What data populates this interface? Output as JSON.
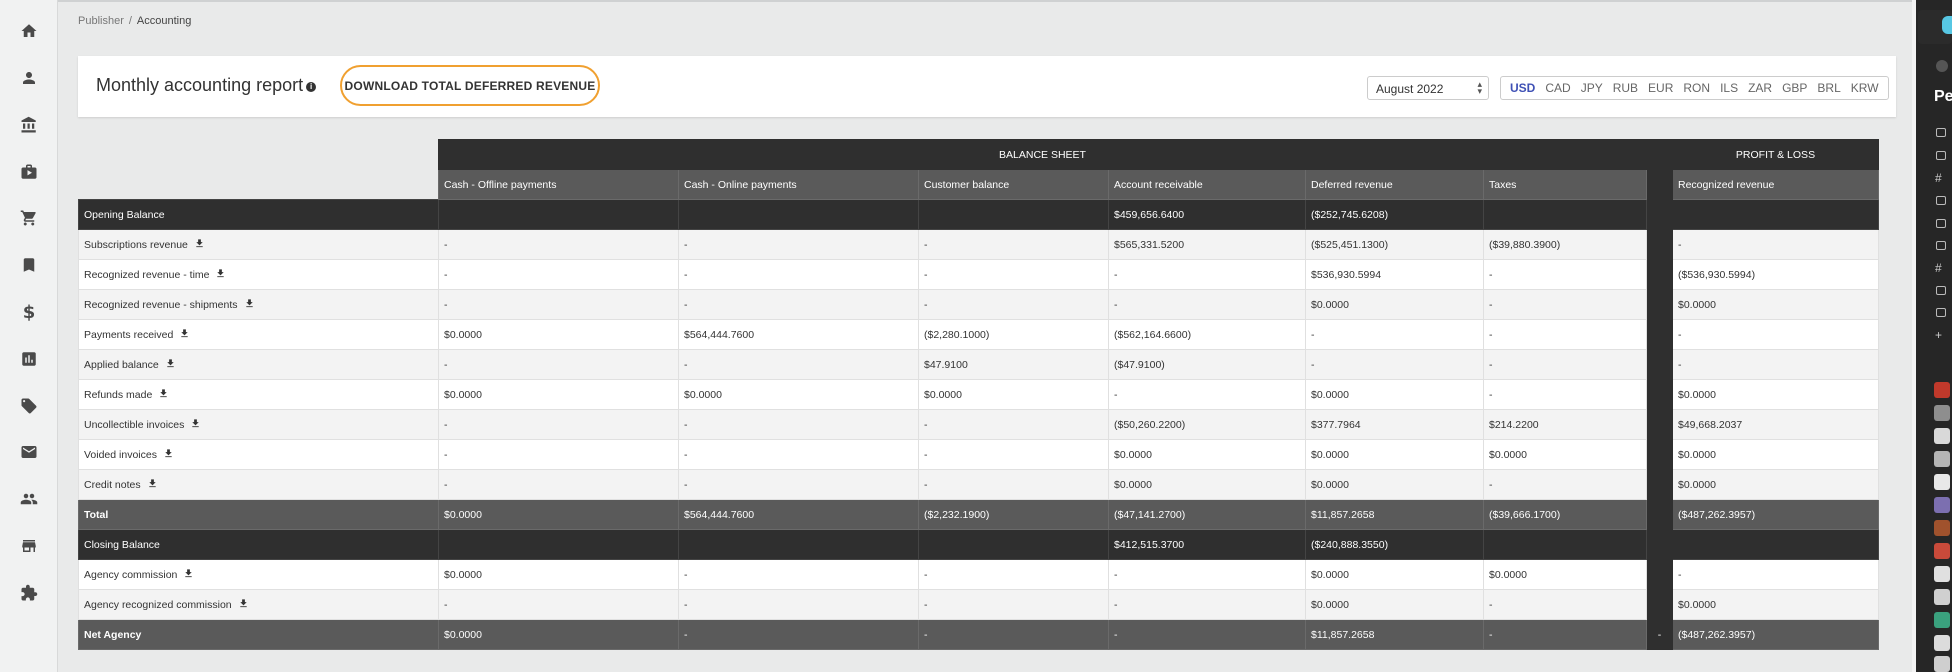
{
  "breadcrumb": {
    "parent": "Publisher",
    "separator": "/",
    "current": "Accounting"
  },
  "header": {
    "title": "Monthly accounting report",
    "info_glyph": "i",
    "download_button": "DOWNLOAD TOTAL DEFERRED REVENUE",
    "month": "August 2022",
    "currencies": [
      "USD",
      "CAD",
      "JPY",
      "RUB",
      "EUR",
      "RON",
      "ILS",
      "ZAR",
      "GBP",
      "BRL",
      "KRW"
    ],
    "active_currency": "USD"
  },
  "sidebar": {
    "icons": [
      "home-icon",
      "person-icon",
      "bank-icon",
      "briefcase-icon",
      "cart-icon",
      "bookmark-icon",
      "dollar-icon",
      "chart-icon",
      "ticket-icon",
      "mail-icon",
      "people-icon",
      "store-icon",
      "puzzle-icon"
    ],
    "dollar_glyph": "$"
  },
  "table": {
    "balance_sheet_label": "BALANCE SHEET",
    "profit_loss_label": "PROFIT & LOSS",
    "columns": [
      "Cash - Offline payments",
      "Cash - Online payments",
      "Customer balance",
      "Account receivable",
      "Deferred revenue",
      "Taxes"
    ],
    "pl_column": "Recognized revenue",
    "rows": [
      {
        "label": "Opening Balance",
        "style": "dark",
        "download": false,
        "cells": [
          "",
          "",
          "",
          "$459,656.6400",
          "($252,745.6208)",
          ""
        ],
        "pl": ""
      },
      {
        "label": "Subscriptions revenue",
        "style": "b",
        "download": true,
        "cells": [
          "-",
          "-",
          "-",
          "$565,331.5200",
          "($525,451.1300)",
          "($39,880.3900)"
        ],
        "pl": "-"
      },
      {
        "label": "Recognized revenue - time",
        "style": "a",
        "download": true,
        "cells": [
          "-",
          "-",
          "-",
          "-",
          "$536,930.5994",
          "-"
        ],
        "pl": "($536,930.5994)"
      },
      {
        "label": "Recognized revenue - shipments",
        "style": "b",
        "download": true,
        "cells": [
          "-",
          "-",
          "-",
          "-",
          "$0.0000",
          "-"
        ],
        "pl": "$0.0000"
      },
      {
        "label": "Payments received",
        "style": "a",
        "download": true,
        "cells": [
          "$0.0000",
          "$564,444.7600",
          "($2,280.1000)",
          "($562,164.6600)",
          "-",
          "-"
        ],
        "pl": "-"
      },
      {
        "label": "Applied balance",
        "style": "b",
        "download": true,
        "cells": [
          "-",
          "-",
          "$47.9100",
          "($47.9100)",
          "-",
          "-"
        ],
        "pl": "-"
      },
      {
        "label": "Refunds made",
        "style": "a",
        "download": true,
        "cells": [
          "$0.0000",
          "$0.0000",
          "$0.0000",
          "-",
          "$0.0000",
          "-"
        ],
        "pl": "$0.0000"
      },
      {
        "label": "Uncollectible invoices",
        "style": "b",
        "download": true,
        "cells": [
          "-",
          "-",
          "-",
          "($50,260.2200)",
          "$377.7964",
          "$214.2200"
        ],
        "pl": "$49,668.2037"
      },
      {
        "label": "Voided invoices",
        "style": "a",
        "download": true,
        "cells": [
          "-",
          "-",
          "-",
          "$0.0000",
          "$0.0000",
          "$0.0000"
        ],
        "pl": "$0.0000"
      },
      {
        "label": "Credit notes",
        "style": "b",
        "download": true,
        "cells": [
          "-",
          "-",
          "-",
          "$0.0000",
          "$0.0000",
          "-"
        ],
        "pl": "$0.0000"
      },
      {
        "label": "Total",
        "style": "total",
        "download": false,
        "cells": [
          "$0.0000",
          "$564,444.7600",
          "($2,232.1900)",
          "($47,141.2700)",
          "$11,857.2658",
          "($39,666.1700)"
        ],
        "pl": "($487,262.3957)"
      },
      {
        "label": "Closing Balance",
        "style": "dark",
        "download": false,
        "cells": [
          "",
          "",
          "",
          "$412,515.3700",
          "($240,888.3550)",
          ""
        ],
        "pl": ""
      },
      {
        "label": "Agency commission",
        "style": "a",
        "download": true,
        "cells": [
          "$0.0000",
          "-",
          "-",
          "-",
          "$0.0000",
          "$0.0000"
        ],
        "pl": "-"
      },
      {
        "label": "Agency recognized commission",
        "style": "b",
        "download": true,
        "cells": [
          "-",
          "-",
          "-",
          "-",
          "$0.0000",
          "-"
        ],
        "pl": "$0.0000"
      },
      {
        "label": "Net Agency",
        "style": "total",
        "download": false,
        "cells": [
          "$0.0000",
          "-",
          "-",
          "-",
          "$11,857.2658",
          "-"
        ],
        "gap": "-",
        "pl": "($487,262.3957)"
      }
    ]
  },
  "right_panel": {
    "label": "Pel"
  }
}
